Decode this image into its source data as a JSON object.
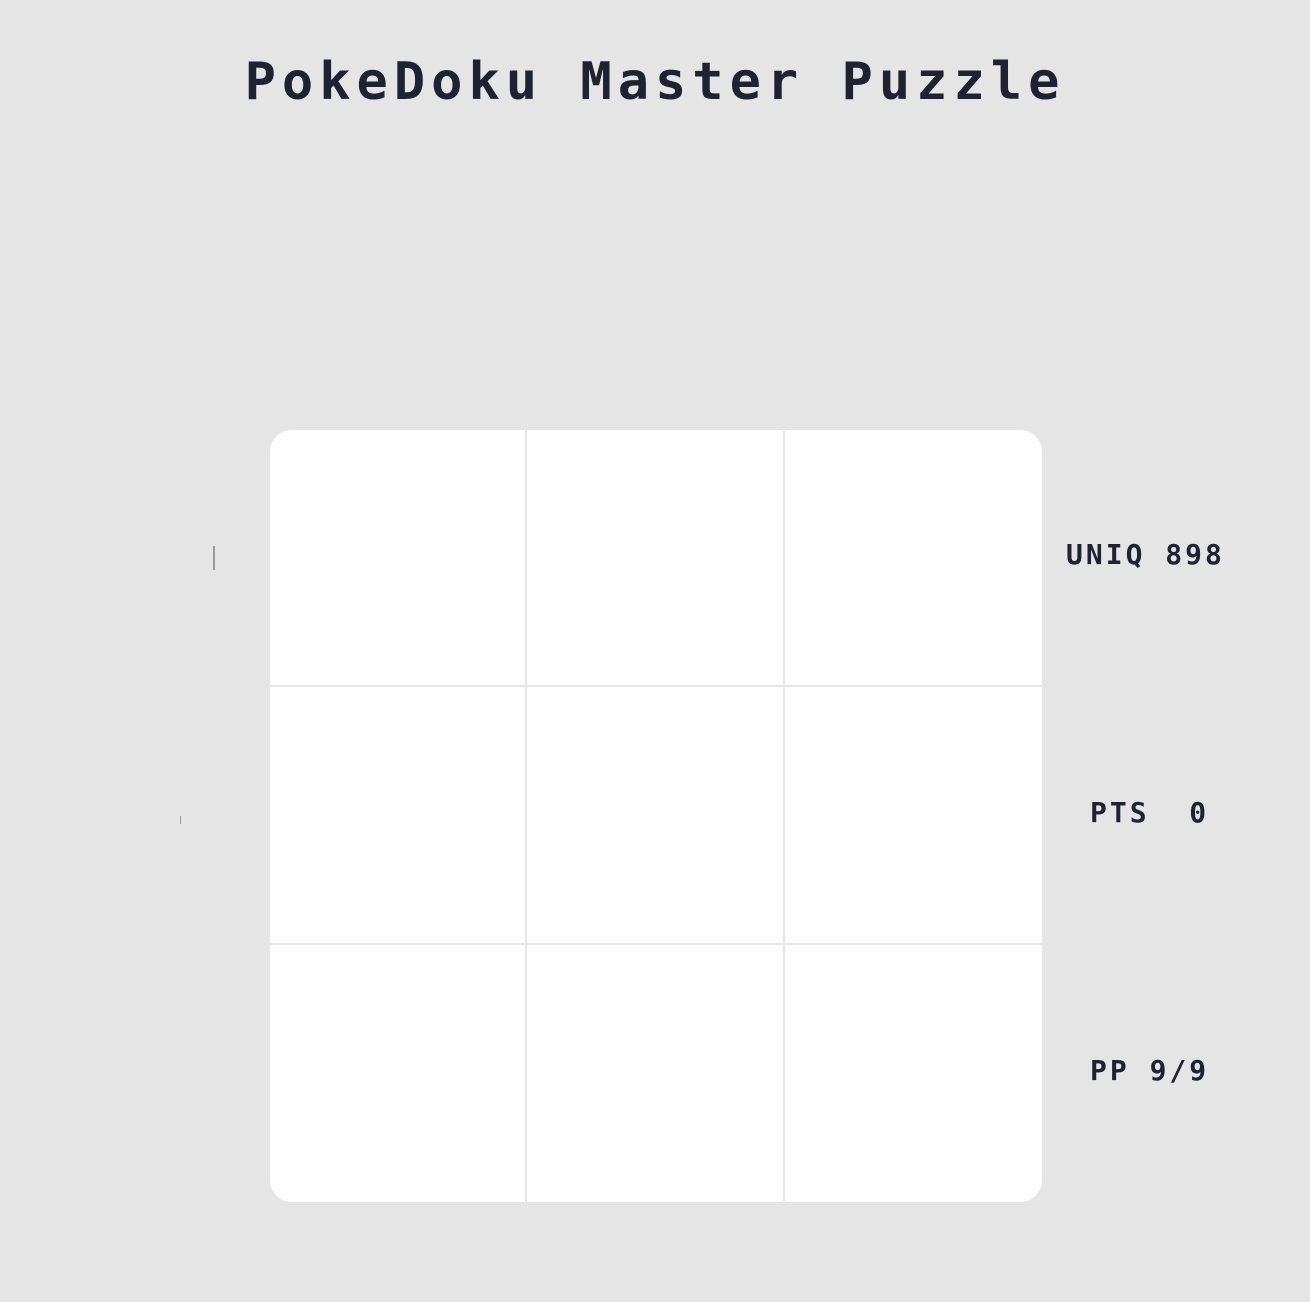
{
  "title": "PokeDoku Master Puzzle",
  "board": {
    "rows": 3,
    "cols": 3,
    "cells": [
      "",
      "",
      "",
      "",
      "",
      "",
      "",
      "",
      ""
    ]
  },
  "stats": {
    "uniq": "UNIQ 898",
    "pts": "PTS  0",
    "pp": "PP 9/9"
  },
  "colors": {
    "background": "#e5e5e5",
    "board": "#ffffff",
    "grid_line": "#e6e6e6",
    "text": "#1f2233"
  }
}
